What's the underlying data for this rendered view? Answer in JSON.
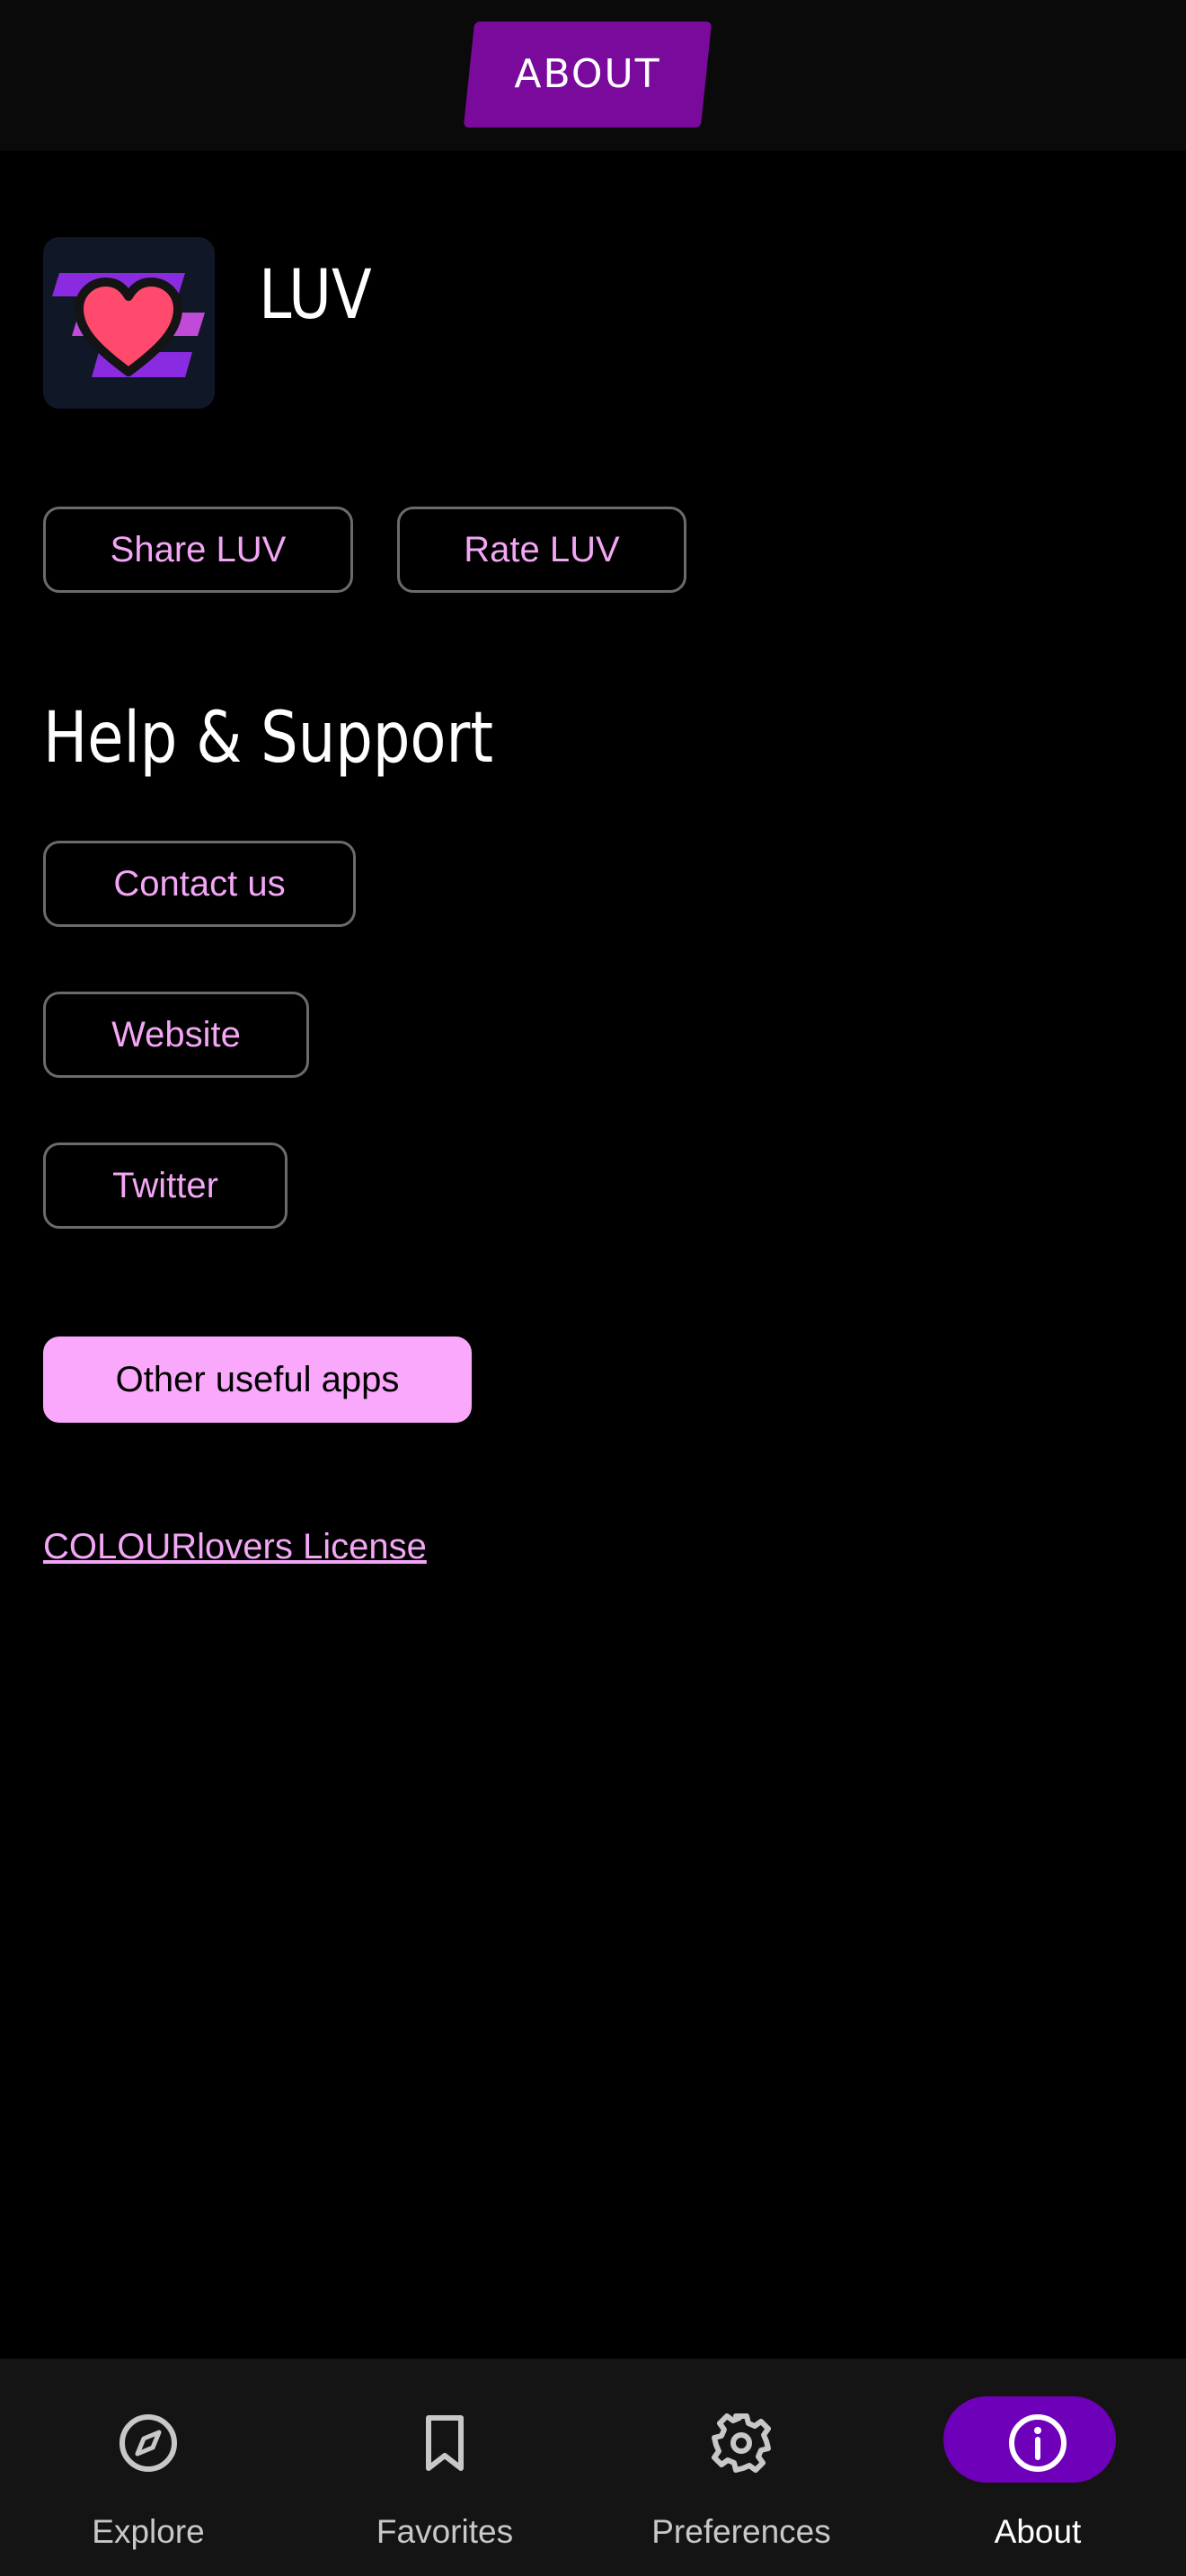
{
  "header": {
    "title": "ABOUT",
    "accent_color": "#7a0a9c"
  },
  "app": {
    "name": "LUV",
    "icon": "luv-heart-logo"
  },
  "actions": {
    "share_label": "Share LUV",
    "rate_label": "Rate LUV"
  },
  "support": {
    "title": "Help & Support",
    "contact_label": "Contact us",
    "website_label": "Website",
    "twitter_label": "Twitter"
  },
  "other_apps_label": "Other useful apps",
  "license_link": "COLOURlovers License",
  "colors": {
    "background": "#000000",
    "link": "#f3a6f5",
    "primary_button": "#f9a8fb",
    "active_nav": "#6d00b8"
  },
  "nav": {
    "items": [
      {
        "label": "Explore",
        "icon": "compass-icon",
        "active": false
      },
      {
        "label": "Favorites",
        "icon": "bookmark-icon",
        "active": false
      },
      {
        "label": "Preferences",
        "icon": "gear-icon",
        "active": false
      },
      {
        "label": "About",
        "icon": "info-icon",
        "active": true
      }
    ]
  }
}
